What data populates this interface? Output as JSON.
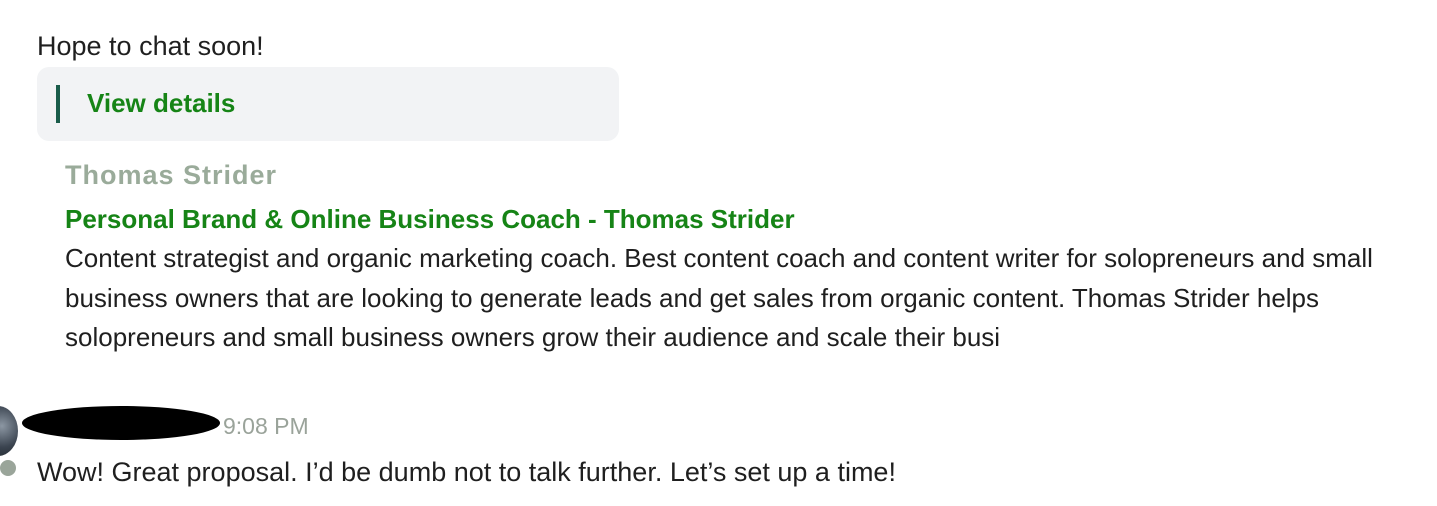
{
  "thread": {
    "closing_message": "Hope to chat soon!",
    "details_link": "View details"
  },
  "link_preview": {
    "site_name": "Thomas Strider",
    "title": "Personal Brand & Online Business Coach - Thomas Strider",
    "description": "Content strategist and organic marketing coach. Best content coach and content writer for solopreneurs and small business owners that are looking to generate leads and get sales from organic content. Thomas Strider helps solopreneurs and small business owners grow their audience and scale their busi"
  },
  "reply": {
    "timestamp": "9:08 PM",
    "message": "Wow! Great proposal. I’d be dumb not to talk further. Let’s set up a time!"
  },
  "colors": {
    "link_green": "#168416",
    "accent_bar": "#1a5c4a",
    "card_background": "#f2f3f5",
    "muted_text": "#9aab9a"
  }
}
